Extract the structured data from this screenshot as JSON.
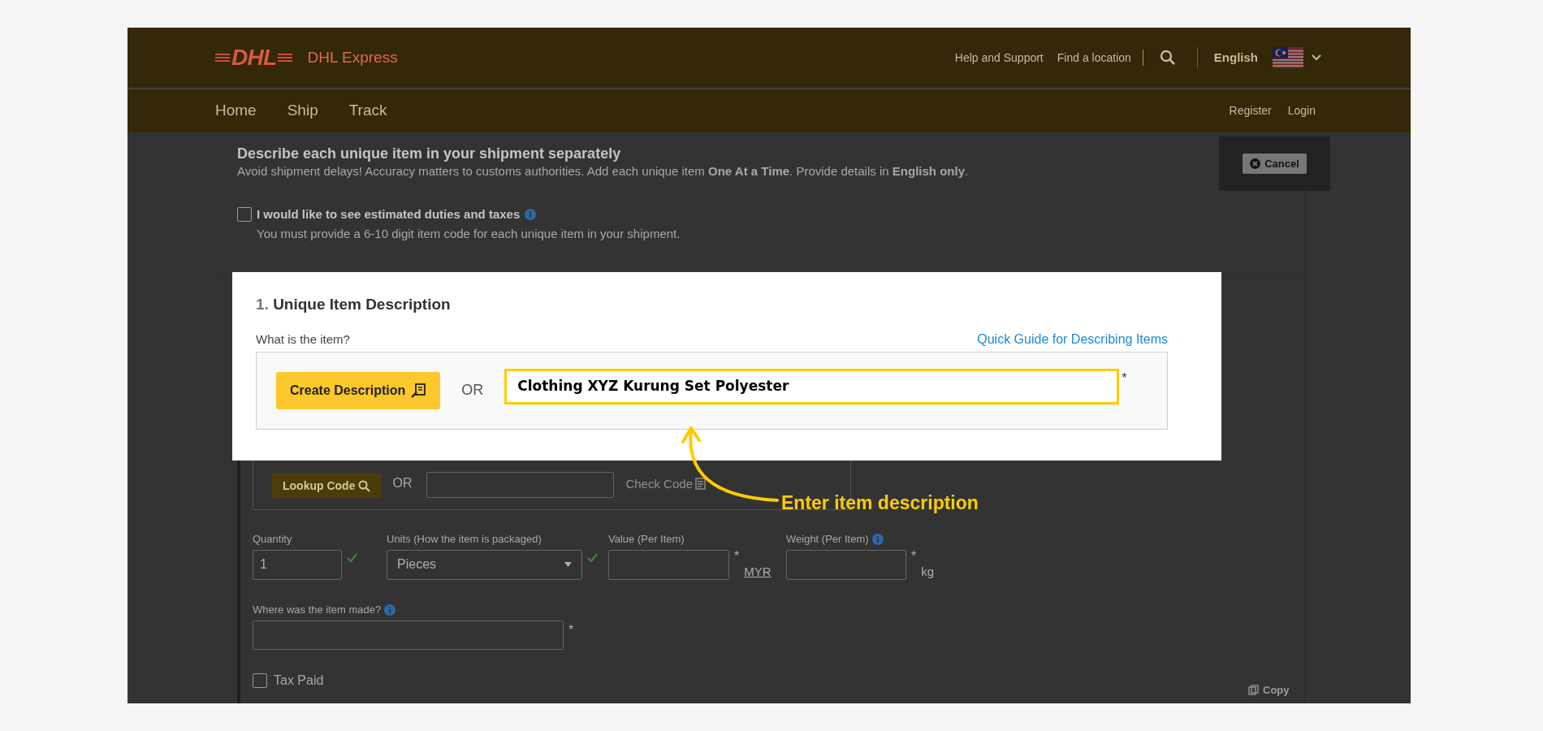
{
  "header": {
    "logo": "DHL",
    "brand": "DHL Express",
    "links": [
      "Help and Support",
      "Find a location"
    ],
    "language": "English"
  },
  "nav": {
    "items": [
      "Home",
      "Ship",
      "Track"
    ],
    "account_links": [
      "Register",
      "Login"
    ]
  },
  "intro": {
    "title": "Describe each unique item in your shipment separately",
    "text": "Avoid shipment delays! Accuracy matters to customs authorities.  Add each unique item **One At a Time**.  Provide details in **English only**."
  },
  "cancel_button": "Cancel",
  "duties_option": {
    "label": "I would like to see estimated duties and taxes",
    "checked": false,
    "hint": "You must provide a 6-10 digit item code for each unique item in your shipment."
  },
  "item_code": {
    "lookup_button": "Lookup Code",
    "or": "OR",
    "check_code": "Check Code"
  },
  "fields": [
    {
      "label": "Quantity",
      "value": "1",
      "kind": "text",
      "valid": true,
      "info": false
    },
    {
      "label": "Units (How the item is packaged)",
      "value": "Pieces",
      "kind": "select",
      "valid": true,
      "info": false
    },
    {
      "label": "Value (Per Item)",
      "kind": "text",
      "valid": false,
      "info": false,
      "required_mark": "*",
      "unit": "MYR",
      "unit_link": true
    },
    {
      "label": "Weight (Per Item)",
      "kind": "text",
      "valid": false,
      "info": true,
      "required_mark": "*",
      "unit": "kg",
      "unit_link": false
    }
  ],
  "origin_field": {
    "label": "Where was the item made?",
    "info": true,
    "required_mark": "*"
  },
  "tax_paid": {
    "label": "Tax Paid",
    "checked": false
  },
  "copy_link": "Copy",
  "highlight": {
    "step": "1.",
    "title": "Unique Item Description",
    "question": "What is the item?",
    "guide_link": "Quick Guide for Describing Items",
    "create_button": "Create Description",
    "or": "OR",
    "description_value": "Clothing XYZ Kurung Set Polyester",
    "required_mark": "*"
  },
  "annotation": {
    "text": "Enter item description"
  }
}
